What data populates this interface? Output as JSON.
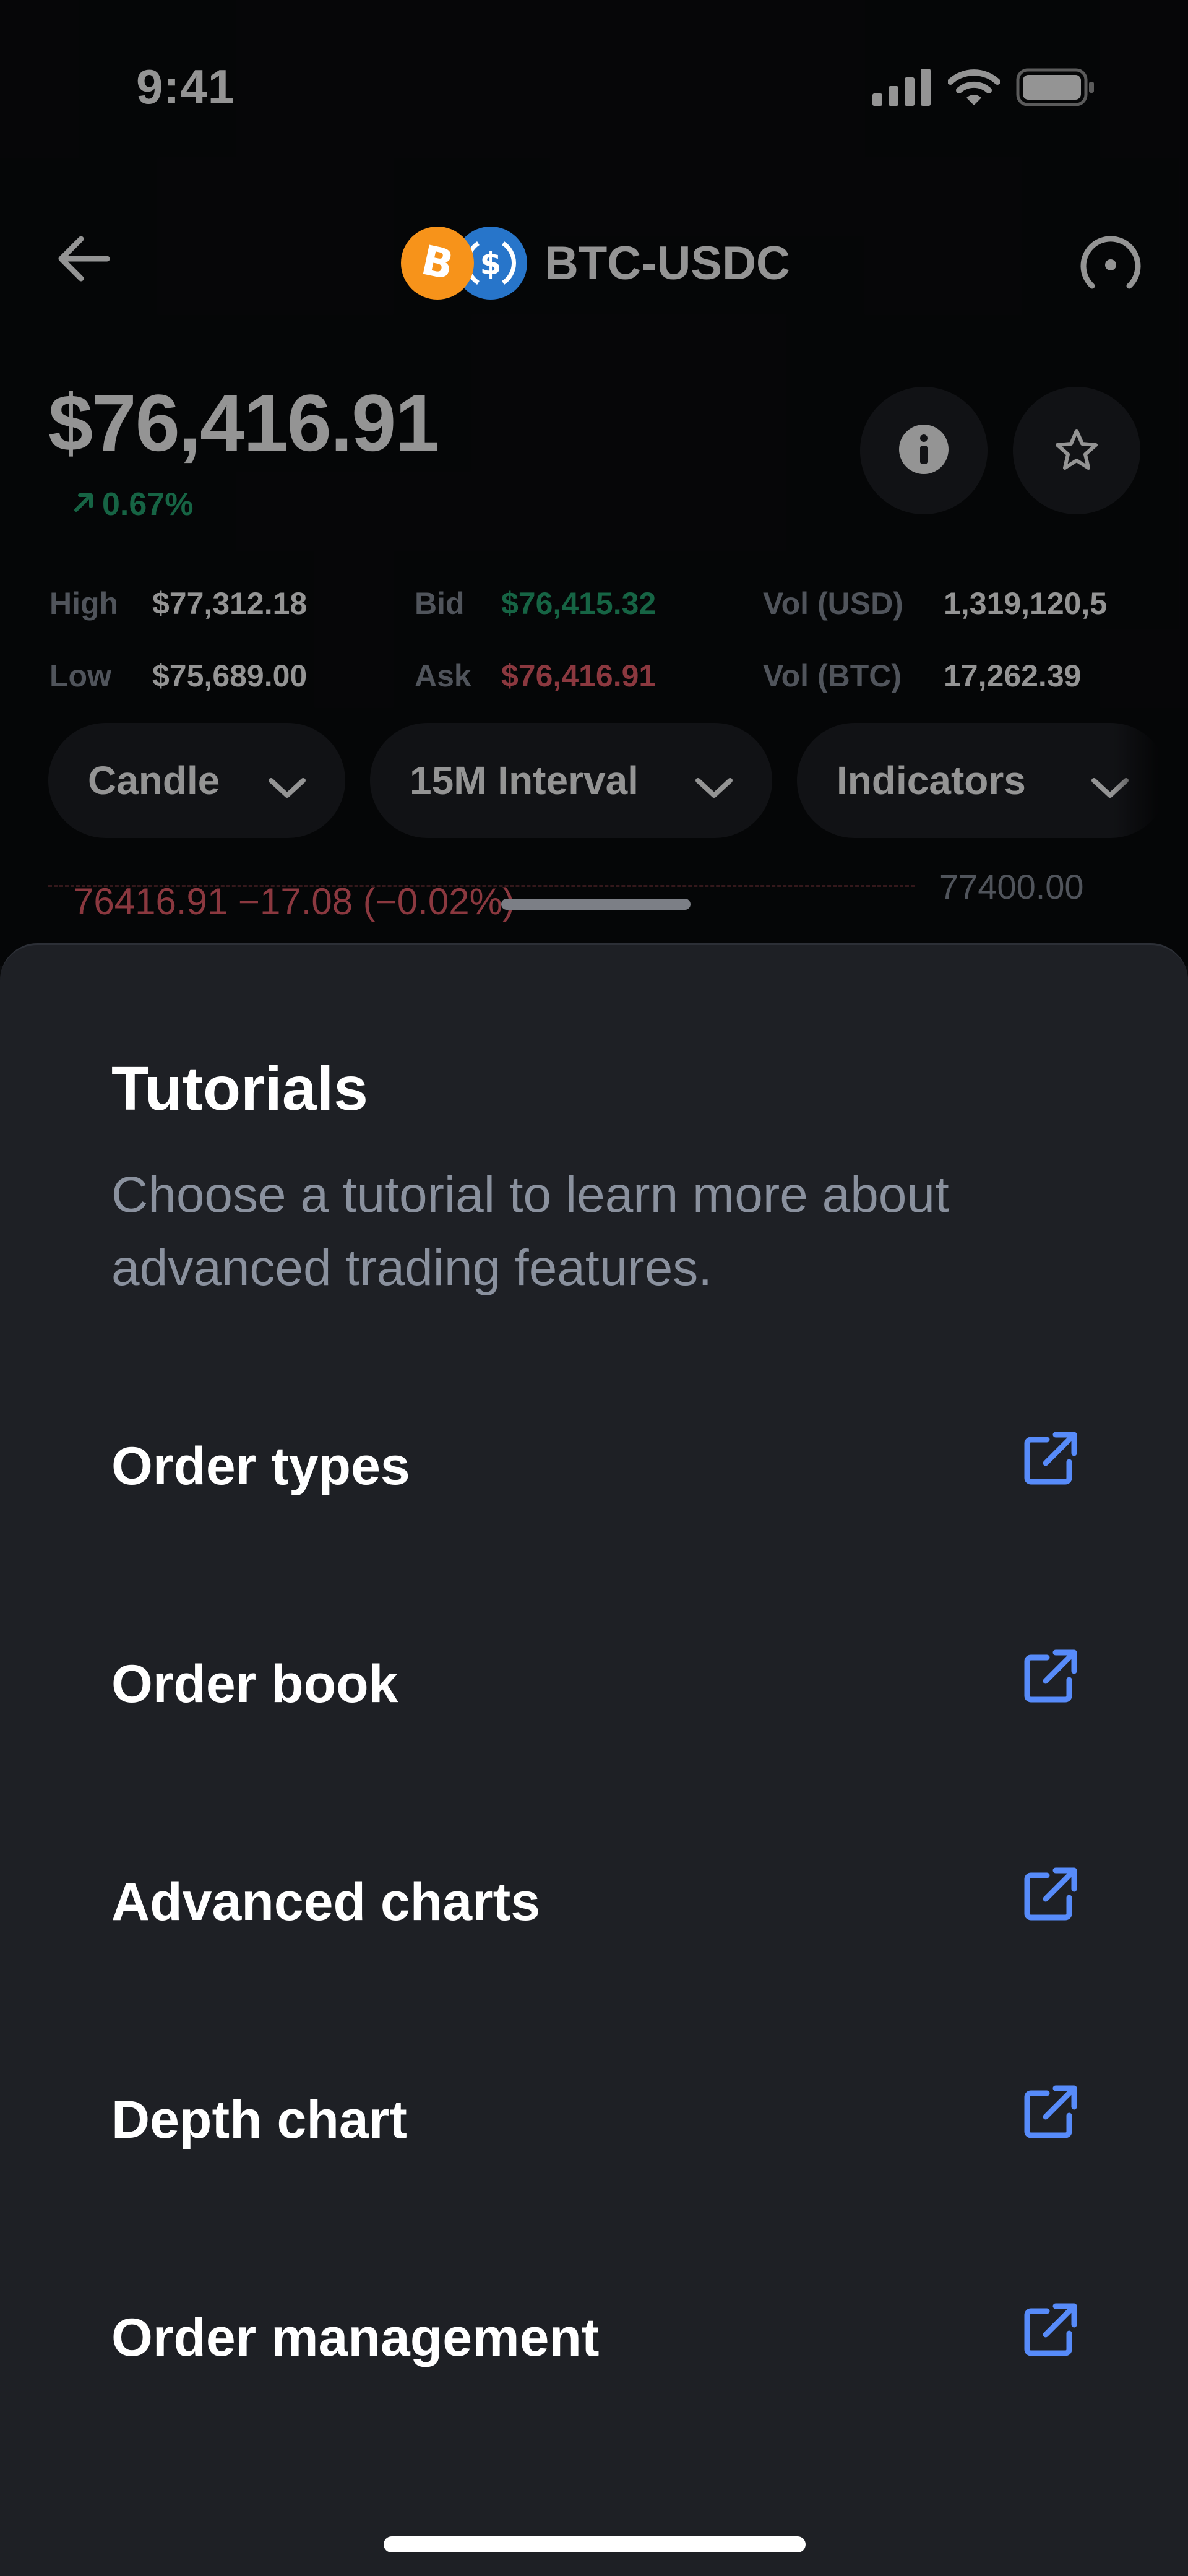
{
  "status_bar": {
    "time": "9:41"
  },
  "header": {
    "pair": "BTC-USDC",
    "back_icon": "arrow-left-icon",
    "gauge_icon": "gauge-icon",
    "base_coin_icon": "bitcoin-icon",
    "quote_coin_icon": "usdc-icon"
  },
  "price": {
    "value": "$76,416.91",
    "change": "0.67%"
  },
  "stats": {
    "high_label": "High",
    "high_value": "$77,312.18",
    "low_label": "Low",
    "low_value": "$75,689.00",
    "bid_label": "Bid",
    "bid_value": "$76,415.32",
    "ask_label": "Ask",
    "ask_value": "$76,416.91",
    "vol_usd_label": "Vol (USD)",
    "vol_usd_value": "1,319,120,5",
    "vol_btc_label": "Vol (BTC)",
    "vol_btc_value": "17,262.39"
  },
  "chart_controls": {
    "type_label": "Candle",
    "interval_label": "15M Interval",
    "indicators_label": "Indicators"
  },
  "chart_peek": {
    "readout": "76416.91  −17.08 (−0.02%)",
    "axis_label": "77400.00"
  },
  "sheet": {
    "title": "Tutorials",
    "subtitle": "Choose a tutorial to learn more about advanced trading features.",
    "items": [
      {
        "label": "Order types"
      },
      {
        "label": "Order book"
      },
      {
        "label": "Advanced charts"
      },
      {
        "label": "Depth chart"
      },
      {
        "label": "Order management"
      }
    ],
    "item_icon": "external-link-icon"
  },
  "colors": {
    "background": "#0a0b0d",
    "sheet": "#1e2025",
    "positive": "#27ad75",
    "negative": "#f0616d",
    "link": "#578bfa",
    "muted": "#8a919e"
  }
}
